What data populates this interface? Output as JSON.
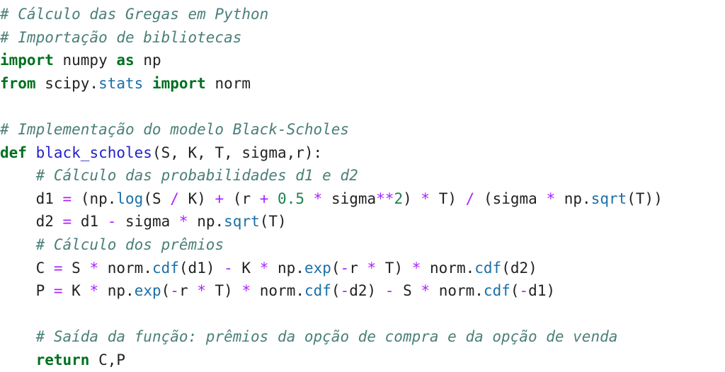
{
  "editor": {
    "language": "Python",
    "background_color": "#ffffff",
    "theme_colors": {
      "comment": "#4a7f78",
      "keyword": "#007020",
      "namespace": "#1a6fa8",
      "builtin": "#1a6fa8",
      "function_name": "#2222cc",
      "operator": "#aa22ff",
      "number": "#208050",
      "plain": "#222222"
    }
  },
  "code": {
    "lines": [
      {
        "index": 1,
        "text": "# Cálculo das Gregas em Python",
        "tokens": [
          {
            "t": "# Cálculo das Gregas em Python",
            "c": "tok-c"
          }
        ]
      },
      {
        "index": 2,
        "text": "# Importação de bibliotecas",
        "tokens": [
          {
            "t": "# Importação de bibliotecas",
            "c": "tok-c"
          }
        ]
      },
      {
        "index": 3,
        "text": "import numpy as np",
        "tokens": [
          {
            "t": "import",
            "c": "tok-k"
          },
          {
            "t": " numpy ",
            "c": "tok-p"
          },
          {
            "t": "as",
            "c": "tok-k"
          },
          {
            "t": " np",
            "c": "tok-p"
          }
        ]
      },
      {
        "index": 4,
        "text": "from scipy.stats import norm",
        "tokens": [
          {
            "t": "from",
            "c": "tok-k"
          },
          {
            "t": " scipy.",
            "c": "tok-p"
          },
          {
            "t": "stats",
            "c": "tok-nn"
          },
          {
            "t": " ",
            "c": "tok-p"
          },
          {
            "t": "import",
            "c": "tok-k"
          },
          {
            "t": " norm",
            "c": "tok-p"
          }
        ]
      },
      {
        "index": 5,
        "text": "",
        "tokens": []
      },
      {
        "index": 6,
        "text": "# Implementação do modelo Black-Scholes",
        "tokens": [
          {
            "t": "# Implementação do modelo Black-Scholes",
            "c": "tok-c"
          }
        ]
      },
      {
        "index": 7,
        "text": "def black_scholes(S, K, T, sigma,r):",
        "tokens": [
          {
            "t": "def",
            "c": "tok-k"
          },
          {
            "t": " ",
            "c": "tok-p"
          },
          {
            "t": "black_scholes",
            "c": "tok-nf"
          },
          {
            "t": "(S, K, T, sigma,r):",
            "c": "tok-p"
          }
        ]
      },
      {
        "index": 8,
        "text": "    # Cálculo das probabilidades d1 e d2",
        "tokens": [
          {
            "t": "    ",
            "c": "tok-p"
          },
          {
            "t": "# Cálculo das probabilidades d1 e d2",
            "c": "tok-c"
          }
        ]
      },
      {
        "index": 9,
        "text": "    d1 = (np.log(S / K) + (r + 0.5 * sigma**2) * T) / (sigma * np.sqrt(T))",
        "tokens": [
          {
            "t": "    d1 ",
            "c": "tok-p"
          },
          {
            "t": "=",
            "c": "tok-o"
          },
          {
            "t": " (np.",
            "c": "tok-p"
          },
          {
            "t": "log",
            "c": "tok-nb"
          },
          {
            "t": "(S ",
            "c": "tok-p"
          },
          {
            "t": "/",
            "c": "tok-o"
          },
          {
            "t": " K) ",
            "c": "tok-p"
          },
          {
            "t": "+",
            "c": "tok-o"
          },
          {
            "t": " (r ",
            "c": "tok-p"
          },
          {
            "t": "+",
            "c": "tok-o"
          },
          {
            "t": " ",
            "c": "tok-p"
          },
          {
            "t": "0.5",
            "c": "tok-m"
          },
          {
            "t": " ",
            "c": "tok-p"
          },
          {
            "t": "*",
            "c": "tok-o"
          },
          {
            "t": " sigma",
            "c": "tok-p"
          },
          {
            "t": "**",
            "c": "tok-o"
          },
          {
            "t": "2",
            "c": "tok-m"
          },
          {
            "t": ") ",
            "c": "tok-p"
          },
          {
            "t": "*",
            "c": "tok-o"
          },
          {
            "t": " T) ",
            "c": "tok-p"
          },
          {
            "t": "/",
            "c": "tok-o"
          },
          {
            "t": " (sigma ",
            "c": "tok-p"
          },
          {
            "t": "*",
            "c": "tok-o"
          },
          {
            "t": " np.",
            "c": "tok-p"
          },
          {
            "t": "sqrt",
            "c": "tok-nb"
          },
          {
            "t": "(T))",
            "c": "tok-p"
          }
        ]
      },
      {
        "index": 10,
        "text": "    d2 = d1 - sigma * np.sqrt(T)",
        "tokens": [
          {
            "t": "    d2 ",
            "c": "tok-p"
          },
          {
            "t": "=",
            "c": "tok-o"
          },
          {
            "t": " d1 ",
            "c": "tok-p"
          },
          {
            "t": "-",
            "c": "tok-o"
          },
          {
            "t": " sigma ",
            "c": "tok-p"
          },
          {
            "t": "*",
            "c": "tok-o"
          },
          {
            "t": " np.",
            "c": "tok-p"
          },
          {
            "t": "sqrt",
            "c": "tok-nb"
          },
          {
            "t": "(T)",
            "c": "tok-p"
          }
        ]
      },
      {
        "index": 11,
        "text": "    # Cálculo dos prêmios",
        "tokens": [
          {
            "t": "    ",
            "c": "tok-p"
          },
          {
            "t": "# Cálculo dos prêmios",
            "c": "tok-c"
          }
        ]
      },
      {
        "index": 12,
        "text": "    C = S * norm.cdf(d1) - K * np.exp(-r * T) * norm.cdf(d2)",
        "tokens": [
          {
            "t": "    C ",
            "c": "tok-p"
          },
          {
            "t": "=",
            "c": "tok-o"
          },
          {
            "t": " S ",
            "c": "tok-p"
          },
          {
            "t": "*",
            "c": "tok-o"
          },
          {
            "t": " norm.",
            "c": "tok-p"
          },
          {
            "t": "cdf",
            "c": "tok-nb"
          },
          {
            "t": "(d1) ",
            "c": "tok-p"
          },
          {
            "t": "-",
            "c": "tok-o"
          },
          {
            "t": " K ",
            "c": "tok-p"
          },
          {
            "t": "*",
            "c": "tok-o"
          },
          {
            "t": " np.",
            "c": "tok-p"
          },
          {
            "t": "exp",
            "c": "tok-nb"
          },
          {
            "t": "(",
            "c": "tok-p"
          },
          {
            "t": "-",
            "c": "tok-o"
          },
          {
            "t": "r ",
            "c": "tok-p"
          },
          {
            "t": "*",
            "c": "tok-o"
          },
          {
            "t": " T) ",
            "c": "tok-p"
          },
          {
            "t": "*",
            "c": "tok-o"
          },
          {
            "t": " norm.",
            "c": "tok-p"
          },
          {
            "t": "cdf",
            "c": "tok-nb"
          },
          {
            "t": "(d2)",
            "c": "tok-p"
          }
        ]
      },
      {
        "index": 13,
        "text": "    P = K * np.exp(-r * T) * norm.cdf(-d2) - S * norm.cdf(-d1)",
        "tokens": [
          {
            "t": "    P ",
            "c": "tok-p"
          },
          {
            "t": "=",
            "c": "tok-o"
          },
          {
            "t": " K ",
            "c": "tok-p"
          },
          {
            "t": "*",
            "c": "tok-o"
          },
          {
            "t": " np.",
            "c": "tok-p"
          },
          {
            "t": "exp",
            "c": "tok-nb"
          },
          {
            "t": "(",
            "c": "tok-p"
          },
          {
            "t": "-",
            "c": "tok-o"
          },
          {
            "t": "r ",
            "c": "tok-p"
          },
          {
            "t": "*",
            "c": "tok-o"
          },
          {
            "t": " T) ",
            "c": "tok-p"
          },
          {
            "t": "*",
            "c": "tok-o"
          },
          {
            "t": " norm.",
            "c": "tok-p"
          },
          {
            "t": "cdf",
            "c": "tok-nb"
          },
          {
            "t": "(",
            "c": "tok-p"
          },
          {
            "t": "-",
            "c": "tok-o"
          },
          {
            "t": "d2) ",
            "c": "tok-p"
          },
          {
            "t": "-",
            "c": "tok-o"
          },
          {
            "t": " S ",
            "c": "tok-p"
          },
          {
            "t": "*",
            "c": "tok-o"
          },
          {
            "t": " norm.",
            "c": "tok-p"
          },
          {
            "t": "cdf",
            "c": "tok-nb"
          },
          {
            "t": "(",
            "c": "tok-p"
          },
          {
            "t": "-",
            "c": "tok-o"
          },
          {
            "t": "d1)",
            "c": "tok-p"
          }
        ]
      },
      {
        "index": 14,
        "text": "",
        "tokens": []
      },
      {
        "index": 15,
        "text": "    # Saída da função: prêmios da opção de compra e da opção de venda",
        "tokens": [
          {
            "t": "    ",
            "c": "tok-p"
          },
          {
            "t": "# Saída da função: prêmios da opção de compra e da opção de venda",
            "c": "tok-c"
          }
        ]
      },
      {
        "index": 16,
        "text": "    return C,P",
        "tokens": [
          {
            "t": "    ",
            "c": "tok-p"
          },
          {
            "t": "return",
            "c": "tok-k"
          },
          {
            "t": " C,P",
            "c": "tok-p"
          }
        ]
      }
    ]
  }
}
